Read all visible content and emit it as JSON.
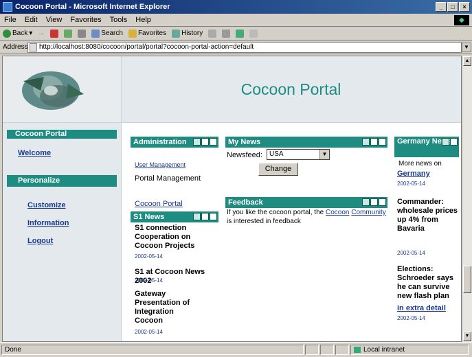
{
  "window": {
    "title": "Cocoon Portal - Microsoft Internet Explorer",
    "controls": [
      "_",
      "□",
      "×"
    ]
  },
  "menu": [
    "File",
    "Edit",
    "View",
    "Favorites",
    "Tools",
    "Help"
  ],
  "toolbar": {
    "back": "Back",
    "forward": "→",
    "search": "Search",
    "favorites": "Favorites",
    "history": "History"
  },
  "address": {
    "label": "Address",
    "url": "http://localhost:8080/cocoon/portal/portal?cocoon-portal-action=default"
  },
  "page": {
    "title": "Cocoon Portal",
    "nav": {
      "head": "Cocoon Portal",
      "welcome": "Welcome",
      "section": "Personalize",
      "items": [
        "Customize",
        "Information",
        "Logout"
      ]
    }
  },
  "portlets": {
    "admin": {
      "title": "Administration",
      "links": [
        "User Management",
        "Portal Management"
      ],
      "cocoon_link": "Cocoon Portal"
    },
    "s1news": {
      "title": "S1 News",
      "items": [
        {
          "title": "S1 connection Cooperation on Cocoon Projects",
          "date": "2002-05-14"
        },
        {
          "title": "S1 at Cocoon News 2002",
          "date": "2002-05-14"
        },
        {
          "title": "Gateway Presentation of Integration Cocoon",
          "date": "2002-05-14"
        }
      ]
    },
    "mynews": {
      "title": "My News",
      "newsfeed_label": "Newsfeed:",
      "selected": "USA",
      "change": "Change"
    },
    "feedback": {
      "title": "Feedback",
      "text_before": "If you like the cocoon portal, the ",
      "link1": "Cocoon",
      "link2": "Community",
      "text_after": " is interested in feedback"
    },
    "germany": {
      "title": "Germany News",
      "intro": "More news on",
      "items": [
        {
          "title": "Germany",
          "date": "2002-05-14"
        },
        {
          "title": "Commander: wholesale prices up 4% from Bavaria",
          "date": "2002-05-14"
        },
        {
          "title": "Elections: Schroeder says he can survive new flash plan",
          "date": "2002-05-14"
        },
        {
          "title": "in extra detail",
          "date": "2002-05-14"
        }
      ]
    }
  },
  "status": {
    "left": "Done",
    "zone": "Local intranet"
  }
}
